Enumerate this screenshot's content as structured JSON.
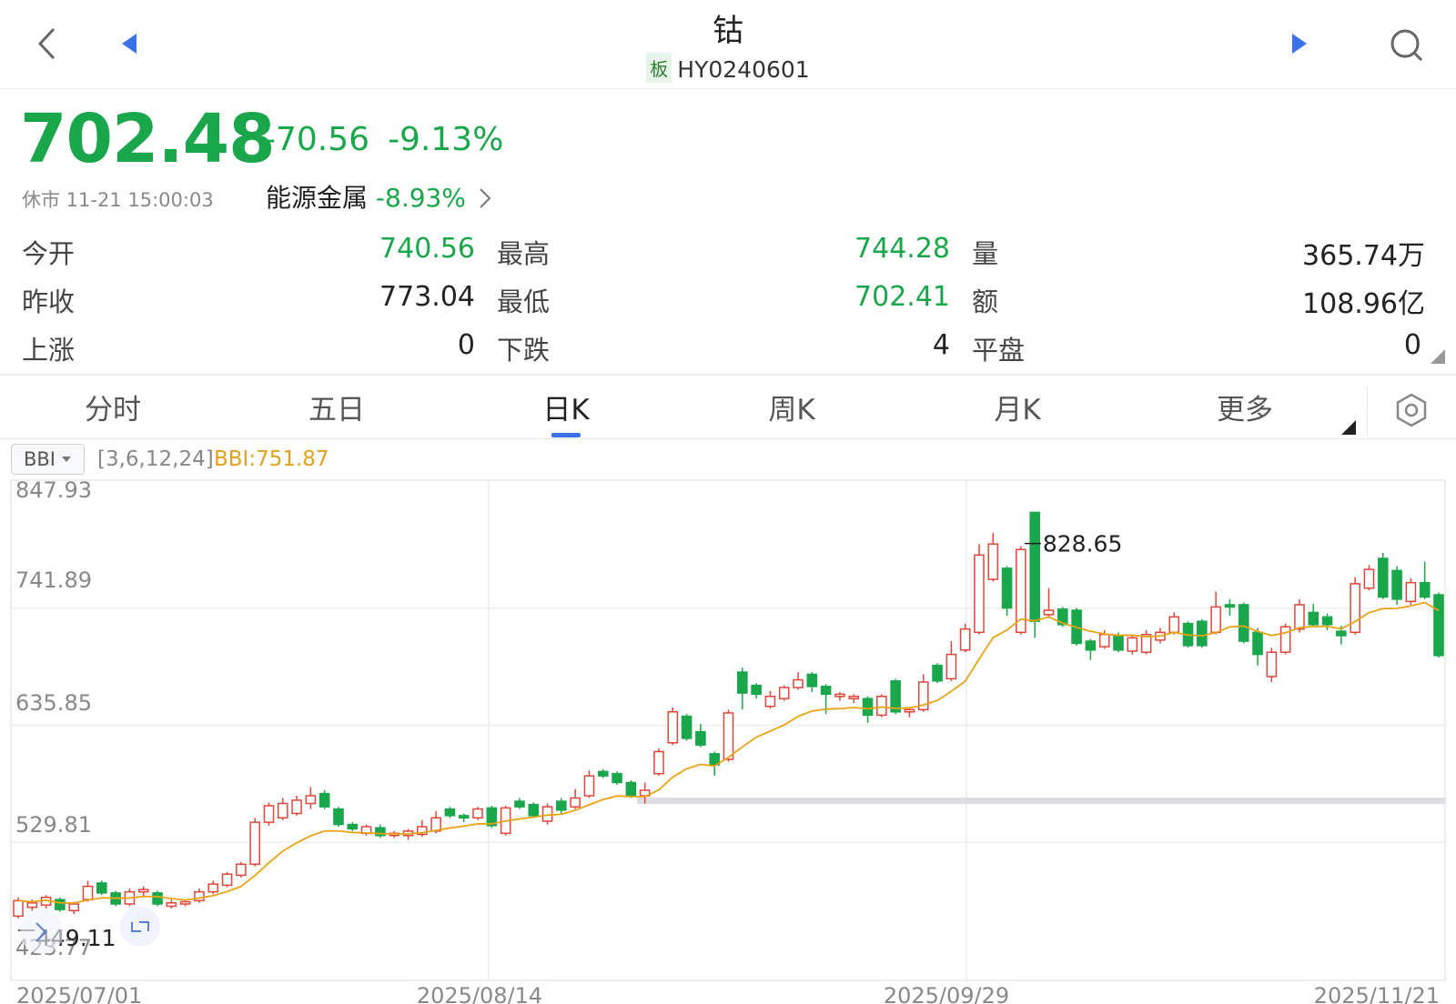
{
  "header": {
    "title": "钴",
    "board_badge": "板",
    "code": "HY0240601"
  },
  "quote": {
    "price": "702.48",
    "change": "-70.56",
    "change_pct": "-9.13%",
    "status_time": "休市 11-21 15:00:03",
    "sector_name": "能源金属",
    "sector_change": "-8.93%"
  },
  "stats": {
    "open_label": "今开",
    "open": "740.56",
    "high_label": "最高",
    "high": "744.28",
    "volume_label": "量",
    "volume": "365.74万",
    "prev_close_label": "昨收",
    "prev_close": "773.04",
    "low_label": "最低",
    "low": "702.41",
    "amount_label": "额",
    "amount": "108.96亿",
    "up_label": "上涨",
    "up": "0",
    "down_label": "下跌",
    "down": "4",
    "flat_label": "平盘",
    "flat": "0"
  },
  "tabs": [
    "分时",
    "五日",
    "日K",
    "周K",
    "月K",
    "更多"
  ],
  "active_tab": "日K",
  "indicator": {
    "name": "BBI",
    "params": "[3,6,12,24]",
    "value": "BBI:751.87"
  },
  "colors": {
    "up": "#e0453a",
    "down": "#1aa64a",
    "bbi": "#e8a317",
    "accent": "#3a73e8"
  },
  "chart_data": {
    "type": "candlestick",
    "y_ticks": [
      "847.93",
      "741.89",
      "635.85",
      "529.81",
      "423.77"
    ],
    "x_ticks": [
      "2025/07/01",
      "2025/08/14",
      "2025/09/29",
      "2025/11/21"
    ],
    "ylim": [
      423.77,
      847.93
    ],
    "max_label": "828.65",
    "min_label": "449.11",
    "series": [
      {
        "o": 463,
        "c": 477,
        "h": 480,
        "l": 461
      },
      {
        "o": 471,
        "c": 475,
        "h": 478,
        "l": 468
      },
      {
        "o": 473,
        "c": 480,
        "h": 482,
        "l": 470
      },
      {
        "o": 478,
        "c": 469,
        "h": 480,
        "l": 467
      },
      {
        "o": 468,
        "c": 474,
        "h": 476,
        "l": 465
      },
      {
        "o": 478,
        "c": 490,
        "h": 495,
        "l": 476
      },
      {
        "o": 493,
        "c": 484,
        "h": 495,
        "l": 482
      },
      {
        "o": 484,
        "c": 474,
        "h": 486,
        "l": 472
      },
      {
        "o": 474,
        "c": 485,
        "h": 488,
        "l": 472
      },
      {
        "o": 485,
        "c": 487,
        "h": 490,
        "l": 480
      },
      {
        "o": 484,
        "c": 474,
        "h": 486,
        "l": 472
      },
      {
        "o": 472,
        "c": 475,
        "h": 478,
        "l": 470
      },
      {
        "o": 474,
        "c": 476,
        "h": 478,
        "l": 472
      },
      {
        "o": 477,
        "c": 485,
        "h": 488,
        "l": 475
      },
      {
        "o": 485,
        "c": 492,
        "h": 495,
        "l": 483
      },
      {
        "o": 491,
        "c": 501,
        "h": 503,
        "l": 489
      },
      {
        "o": 500,
        "c": 510,
        "h": 512,
        "l": 498
      },
      {
        "o": 510,
        "c": 548,
        "h": 552,
        "l": 508
      },
      {
        "o": 548,
        "c": 563,
        "h": 566,
        "l": 545
      },
      {
        "o": 552,
        "c": 565,
        "h": 570,
        "l": 550
      },
      {
        "o": 556,
        "c": 568,
        "h": 572,
        "l": 554
      },
      {
        "o": 565,
        "c": 572,
        "h": 580,
        "l": 560
      },
      {
        "o": 574,
        "c": 562,
        "h": 577,
        "l": 560
      },
      {
        "o": 560,
        "c": 546,
        "h": 562,
        "l": 544
      },
      {
        "o": 546,
        "c": 542,
        "h": 548,
        "l": 540
      },
      {
        "o": 538,
        "c": 544,
        "h": 546,
        "l": 536
      },
      {
        "o": 543,
        "c": 536,
        "h": 546,
        "l": 534
      },
      {
        "o": 536,
        "c": 538,
        "h": 540,
        "l": 534
      },
      {
        "o": 536,
        "c": 540,
        "h": 542,
        "l": 532
      },
      {
        "o": 537,
        "c": 544,
        "h": 550,
        "l": 535
      },
      {
        "o": 540,
        "c": 552,
        "h": 558,
        "l": 538
      },
      {
        "o": 560,
        "c": 554,
        "h": 562,
        "l": 552
      },
      {
        "o": 554,
        "c": 552,
        "h": 556,
        "l": 548
      },
      {
        "o": 552,
        "c": 560,
        "h": 562,
        "l": 550
      },
      {
        "o": 561,
        "c": 545,
        "h": 563,
        "l": 543
      },
      {
        "o": 538,
        "c": 561,
        "h": 563,
        "l": 536
      },
      {
        "o": 567,
        "c": 562,
        "h": 570,
        "l": 560
      },
      {
        "o": 564,
        "c": 554,
        "h": 566,
        "l": 552
      },
      {
        "o": 549,
        "c": 562,
        "h": 565,
        "l": 546
      },
      {
        "o": 567,
        "c": 559,
        "h": 570,
        "l": 556
      },
      {
        "o": 562,
        "c": 570,
        "h": 578,
        "l": 560
      },
      {
        "o": 572,
        "c": 590,
        "h": 595,
        "l": 570
      },
      {
        "o": 594,
        "c": 590,
        "h": 596,
        "l": 588
      },
      {
        "o": 592,
        "c": 584,
        "h": 594,
        "l": 582
      },
      {
        "o": 584,
        "c": 572,
        "h": 586,
        "l": 570
      },
      {
        "o": 572,
        "c": 577,
        "h": 584,
        "l": 565
      },
      {
        "o": 592,
        "c": 612,
        "h": 615,
        "l": 590
      },
      {
        "o": 620,
        "c": 648,
        "h": 652,
        "l": 618
      },
      {
        "o": 644,
        "c": 624,
        "h": 646,
        "l": 622
      },
      {
        "o": 630,
        "c": 618,
        "h": 637,
        "l": 616
      },
      {
        "o": 610,
        "c": 600,
        "h": 612,
        "l": 590
      },
      {
        "o": 605,
        "c": 647,
        "h": 650,
        "l": 603
      },
      {
        "o": 684,
        "c": 665,
        "h": 688,
        "l": 650
      },
      {
        "o": 672,
        "c": 664,
        "h": 674,
        "l": 660
      },
      {
        "o": 653,
        "c": 662,
        "h": 667,
        "l": 651
      },
      {
        "o": 660,
        "c": 670,
        "h": 672,
        "l": 658
      },
      {
        "o": 670,
        "c": 677,
        "h": 684,
        "l": 668
      },
      {
        "o": 682,
        "c": 671,
        "h": 684,
        "l": 666
      },
      {
        "o": 671,
        "c": 664,
        "h": 673,
        "l": 646
      },
      {
        "o": 662,
        "c": 664,
        "h": 666,
        "l": 658
      },
      {
        "o": 660,
        "c": 662,
        "h": 664,
        "l": 656
      },
      {
        "o": 660,
        "c": 645,
        "h": 662,
        "l": 638
      },
      {
        "o": 645,
        "c": 662,
        "h": 664,
        "l": 643
      },
      {
        "o": 676,
        "c": 648,
        "h": 678,
        "l": 646
      },
      {
        "o": 648,
        "c": 650,
        "h": 652,
        "l": 643
      },
      {
        "o": 650,
        "c": 675,
        "h": 682,
        "l": 648
      },
      {
        "o": 690,
        "c": 676,
        "h": 692,
        "l": 674
      },
      {
        "o": 678,
        "c": 700,
        "h": 712,
        "l": 676
      },
      {
        "o": 704,
        "c": 723,
        "h": 728,
        "l": 702
      },
      {
        "o": 720,
        "c": 790,
        "h": 800,
        "l": 718
      },
      {
        "o": 768,
        "c": 800,
        "h": 810,
        "l": 766
      },
      {
        "o": 778,
        "c": 742,
        "h": 780,
        "l": 735
      },
      {
        "o": 720,
        "c": 795,
        "h": 798,
        "l": 718
      },
      {
        "o": 828.65,
        "c": 730,
        "h": 828.65,
        "l": 715
      },
      {
        "o": 736,
        "c": 740,
        "h": 760,
        "l": 733
      },
      {
        "o": 741,
        "c": 727,
        "h": 743,
        "l": 725
      },
      {
        "o": 740,
        "c": 710,
        "h": 742,
        "l": 708
      },
      {
        "o": 712,
        "c": 704,
        "h": 714,
        "l": 695
      },
      {
        "o": 707,
        "c": 718,
        "h": 722,
        "l": 705
      },
      {
        "o": 717,
        "c": 704,
        "h": 720,
        "l": 702
      },
      {
        "o": 703,
        "c": 715,
        "h": 718,
        "l": 700
      },
      {
        "o": 702,
        "c": 718,
        "h": 722,
        "l": 700
      },
      {
        "o": 713,
        "c": 720,
        "h": 724,
        "l": 710
      },
      {
        "o": 720,
        "c": 734,
        "h": 738,
        "l": 718
      },
      {
        "o": 728,
        "c": 708,
        "h": 730,
        "l": 706
      },
      {
        "o": 730,
        "c": 708,
        "h": 732,
        "l": 706
      },
      {
        "o": 720,
        "c": 743,
        "h": 757,
        "l": 718
      },
      {
        "o": 745,
        "c": 743,
        "h": 750,
        "l": 735
      },
      {
        "o": 745,
        "c": 712,
        "h": 747,
        "l": 710
      },
      {
        "o": 720,
        "c": 700,
        "h": 724,
        "l": 690
      },
      {
        "o": 680,
        "c": 702,
        "h": 706,
        "l": 675
      },
      {
        "o": 702,
        "c": 725,
        "h": 728,
        "l": 700
      },
      {
        "o": 723,
        "c": 745,
        "h": 750,
        "l": 720
      },
      {
        "o": 738,
        "c": 727,
        "h": 746,
        "l": 725
      },
      {
        "o": 734,
        "c": 727,
        "h": 737,
        "l": 722
      },
      {
        "o": 721,
        "c": 717,
        "h": 726,
        "l": 709
      },
      {
        "o": 720,
        "c": 764,
        "h": 770,
        "l": 718
      },
      {
        "o": 760,
        "c": 777,
        "h": 781,
        "l": 758
      },
      {
        "o": 787,
        "c": 752,
        "h": 792,
        "l": 750
      },
      {
        "o": 776,
        "c": 750,
        "h": 780,
        "l": 745
      },
      {
        "o": 748,
        "c": 765,
        "h": 769,
        "l": 745
      },
      {
        "o": 765,
        "c": 752,
        "h": 784,
        "l": 750
      },
      {
        "o": 754,
        "c": 699,
        "h": 756,
        "l": 697
      }
    ],
    "bbi_last": 751.87
  }
}
